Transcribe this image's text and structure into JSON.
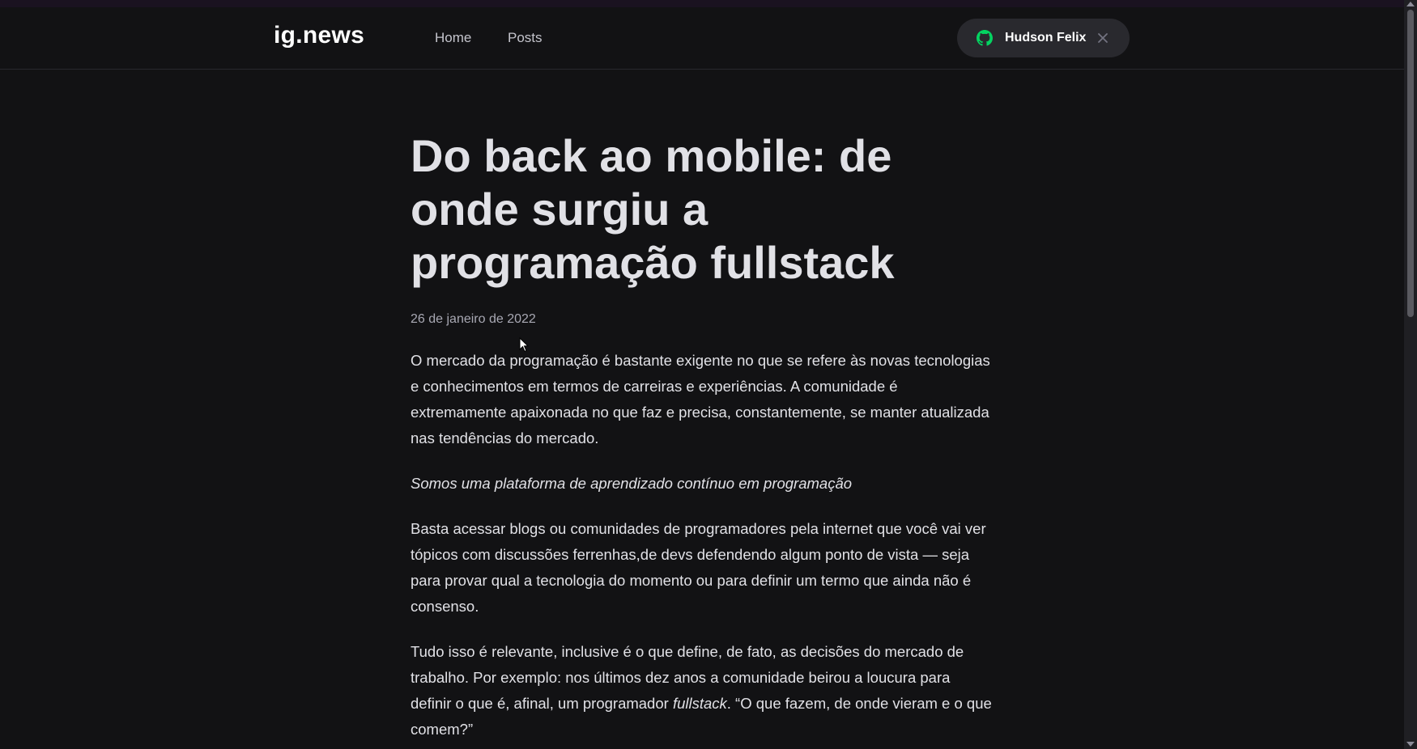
{
  "header": {
    "logo": "ig.news",
    "nav": [
      {
        "label": "Home"
      },
      {
        "label": "Posts"
      }
    ],
    "signin": {
      "icon": "github-icon",
      "user_name": "Hudson Felix",
      "close_icon": "close-icon",
      "icon_color": "#04d361"
    }
  },
  "post": {
    "title": "Do back ao mobile: de onde surgiu a programação fullstack",
    "date": "26 de janeiro de 2022",
    "paragraphs": [
      "O mercado da programação é bastante exigente no que se refere às novas tecnologias e conhecimentos em termos de carreiras e experiências. A comunidade é extremamente apaixonada no que faz e precisa, constantemente, se manter atualizada nas tendências do mercado.",
      "Somos uma plataforma de aprendizado contínuo em programação",
      "Basta acessar blogs ou comunidades de programadores pela internet que você vai ver tópicos com discussões ferrenhas,de devs defendendo algum ponto de vista — seja para provar qual a tecnologia do momento ou para definir um termo que ainda não é consenso.",
      "Tudo isso é relevante, inclusive é o que define, de fato, as decisões do mercado de trabalho. Por exemplo: nos últimos dez anos a comunidade beirou a loucura para definir o que é, afinal, um programador ",
      "fullstack",
      ". “O que fazem, de onde vieram e o que comem?”"
    ]
  },
  "colors": {
    "background": "#121214",
    "accent": "#04d361",
    "button_bg": "#29292e"
  }
}
